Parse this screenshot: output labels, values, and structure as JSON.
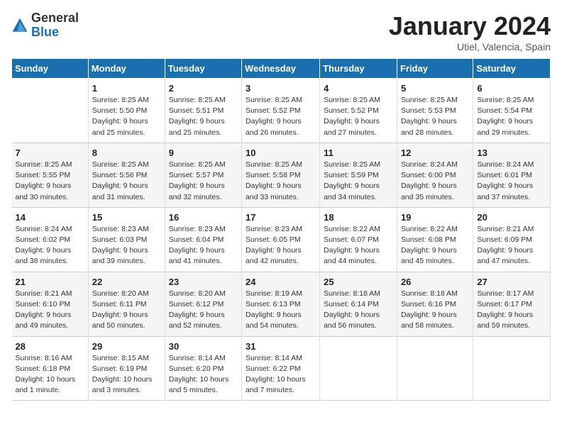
{
  "logo": {
    "general": "General",
    "blue": "Blue"
  },
  "title": "January 2024",
  "location": "Utiel, Valencia, Spain",
  "weekdays": [
    "Sunday",
    "Monday",
    "Tuesday",
    "Wednesday",
    "Thursday",
    "Friday",
    "Saturday"
  ],
  "weeks": [
    [
      {
        "day": "",
        "info": ""
      },
      {
        "day": "1",
        "info": "Sunrise: 8:25 AM\nSunset: 5:50 PM\nDaylight: 9 hours\nand 25 minutes."
      },
      {
        "day": "2",
        "info": "Sunrise: 8:25 AM\nSunset: 5:51 PM\nDaylight: 9 hours\nand 25 minutes."
      },
      {
        "day": "3",
        "info": "Sunrise: 8:25 AM\nSunset: 5:52 PM\nDaylight: 9 hours\nand 26 minutes."
      },
      {
        "day": "4",
        "info": "Sunrise: 8:25 AM\nSunset: 5:52 PM\nDaylight: 9 hours\nand 27 minutes."
      },
      {
        "day": "5",
        "info": "Sunrise: 8:25 AM\nSunset: 5:53 PM\nDaylight: 9 hours\nand 28 minutes."
      },
      {
        "day": "6",
        "info": "Sunrise: 8:25 AM\nSunset: 5:54 PM\nDaylight: 9 hours\nand 29 minutes."
      }
    ],
    [
      {
        "day": "7",
        "info": "Sunrise: 8:25 AM\nSunset: 5:55 PM\nDaylight: 9 hours\nand 30 minutes."
      },
      {
        "day": "8",
        "info": "Sunrise: 8:25 AM\nSunset: 5:56 PM\nDaylight: 9 hours\nand 31 minutes."
      },
      {
        "day": "9",
        "info": "Sunrise: 8:25 AM\nSunset: 5:57 PM\nDaylight: 9 hours\nand 32 minutes."
      },
      {
        "day": "10",
        "info": "Sunrise: 8:25 AM\nSunset: 5:58 PM\nDaylight: 9 hours\nand 33 minutes."
      },
      {
        "day": "11",
        "info": "Sunrise: 8:25 AM\nSunset: 5:59 PM\nDaylight: 9 hours\nand 34 minutes."
      },
      {
        "day": "12",
        "info": "Sunrise: 8:24 AM\nSunset: 6:00 PM\nDaylight: 9 hours\nand 35 minutes."
      },
      {
        "day": "13",
        "info": "Sunrise: 8:24 AM\nSunset: 6:01 PM\nDaylight: 9 hours\nand 37 minutes."
      }
    ],
    [
      {
        "day": "14",
        "info": "Sunrise: 8:24 AM\nSunset: 6:02 PM\nDaylight: 9 hours\nand 38 minutes."
      },
      {
        "day": "15",
        "info": "Sunrise: 8:23 AM\nSunset: 6:03 PM\nDaylight: 9 hours\nand 39 minutes."
      },
      {
        "day": "16",
        "info": "Sunrise: 8:23 AM\nSunset: 6:04 PM\nDaylight: 9 hours\nand 41 minutes."
      },
      {
        "day": "17",
        "info": "Sunrise: 8:23 AM\nSunset: 6:05 PM\nDaylight: 9 hours\nand 42 minutes."
      },
      {
        "day": "18",
        "info": "Sunrise: 8:22 AM\nSunset: 6:07 PM\nDaylight: 9 hours\nand 44 minutes."
      },
      {
        "day": "19",
        "info": "Sunrise: 8:22 AM\nSunset: 6:08 PM\nDaylight: 9 hours\nand 45 minutes."
      },
      {
        "day": "20",
        "info": "Sunrise: 8:21 AM\nSunset: 6:09 PM\nDaylight: 9 hours\nand 47 minutes."
      }
    ],
    [
      {
        "day": "21",
        "info": "Sunrise: 8:21 AM\nSunset: 6:10 PM\nDaylight: 9 hours\nand 49 minutes."
      },
      {
        "day": "22",
        "info": "Sunrise: 8:20 AM\nSunset: 6:11 PM\nDaylight: 9 hours\nand 50 minutes."
      },
      {
        "day": "23",
        "info": "Sunrise: 8:20 AM\nSunset: 6:12 PM\nDaylight: 9 hours\nand 52 minutes."
      },
      {
        "day": "24",
        "info": "Sunrise: 8:19 AM\nSunset: 6:13 PM\nDaylight: 9 hours\nand 54 minutes."
      },
      {
        "day": "25",
        "info": "Sunrise: 8:18 AM\nSunset: 6:14 PM\nDaylight: 9 hours\nand 56 minutes."
      },
      {
        "day": "26",
        "info": "Sunrise: 8:18 AM\nSunset: 6:16 PM\nDaylight: 9 hours\nand 58 minutes."
      },
      {
        "day": "27",
        "info": "Sunrise: 8:17 AM\nSunset: 6:17 PM\nDaylight: 9 hours\nand 59 minutes."
      }
    ],
    [
      {
        "day": "28",
        "info": "Sunrise: 8:16 AM\nSunset: 6:18 PM\nDaylight: 10 hours\nand 1 minute."
      },
      {
        "day": "29",
        "info": "Sunrise: 8:15 AM\nSunset: 6:19 PM\nDaylight: 10 hours\nand 3 minutes."
      },
      {
        "day": "30",
        "info": "Sunrise: 8:14 AM\nSunset: 6:20 PM\nDaylight: 10 hours\nand 5 minutes."
      },
      {
        "day": "31",
        "info": "Sunrise: 8:14 AM\nSunset: 6:22 PM\nDaylight: 10 hours\nand 7 minutes."
      },
      {
        "day": "",
        "info": ""
      },
      {
        "day": "",
        "info": ""
      },
      {
        "day": "",
        "info": ""
      }
    ]
  ]
}
